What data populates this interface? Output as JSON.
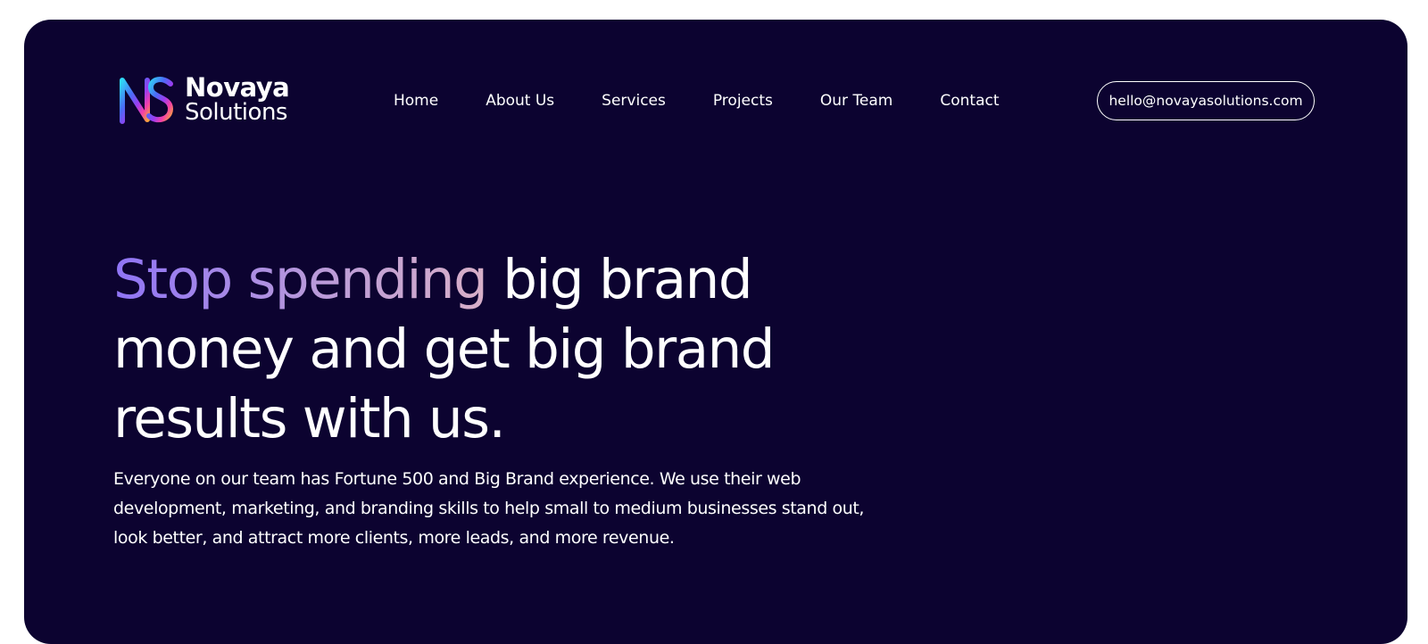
{
  "brand": {
    "name_line1": "Novaya",
    "name_line2": "Solutions",
    "logo_icon": "ns-monogram-icon",
    "logo_gradient": [
      "#2fd9f5",
      "#4a6cf7",
      "#9b3cf0",
      "#f43fa8",
      "#f9a23c"
    ]
  },
  "nav": {
    "items": [
      {
        "label": "Home"
      },
      {
        "label": "About Us"
      },
      {
        "label": "Services"
      },
      {
        "label": "Projects"
      },
      {
        "label": "Our Team"
      },
      {
        "label": "Contact"
      }
    ]
  },
  "contact": {
    "email": "hello@novayasolutions.com"
  },
  "hero": {
    "headline_accent": "Stop spending",
    "headline_rest": " big brand money and get big brand results with us.",
    "subtext": "Everyone on our team has Fortune 500 and Big Brand experience. We use their web development, marketing, and branding skills to help small to medium businesses stand out, look better, and attract more clients, more leads, and more revenue."
  },
  "colors": {
    "background": "#0c0330",
    "page": "#ffffff",
    "text": "#ffffff",
    "accent_gradient": [
      "#8f74f6",
      "#d8b0c8"
    ]
  }
}
